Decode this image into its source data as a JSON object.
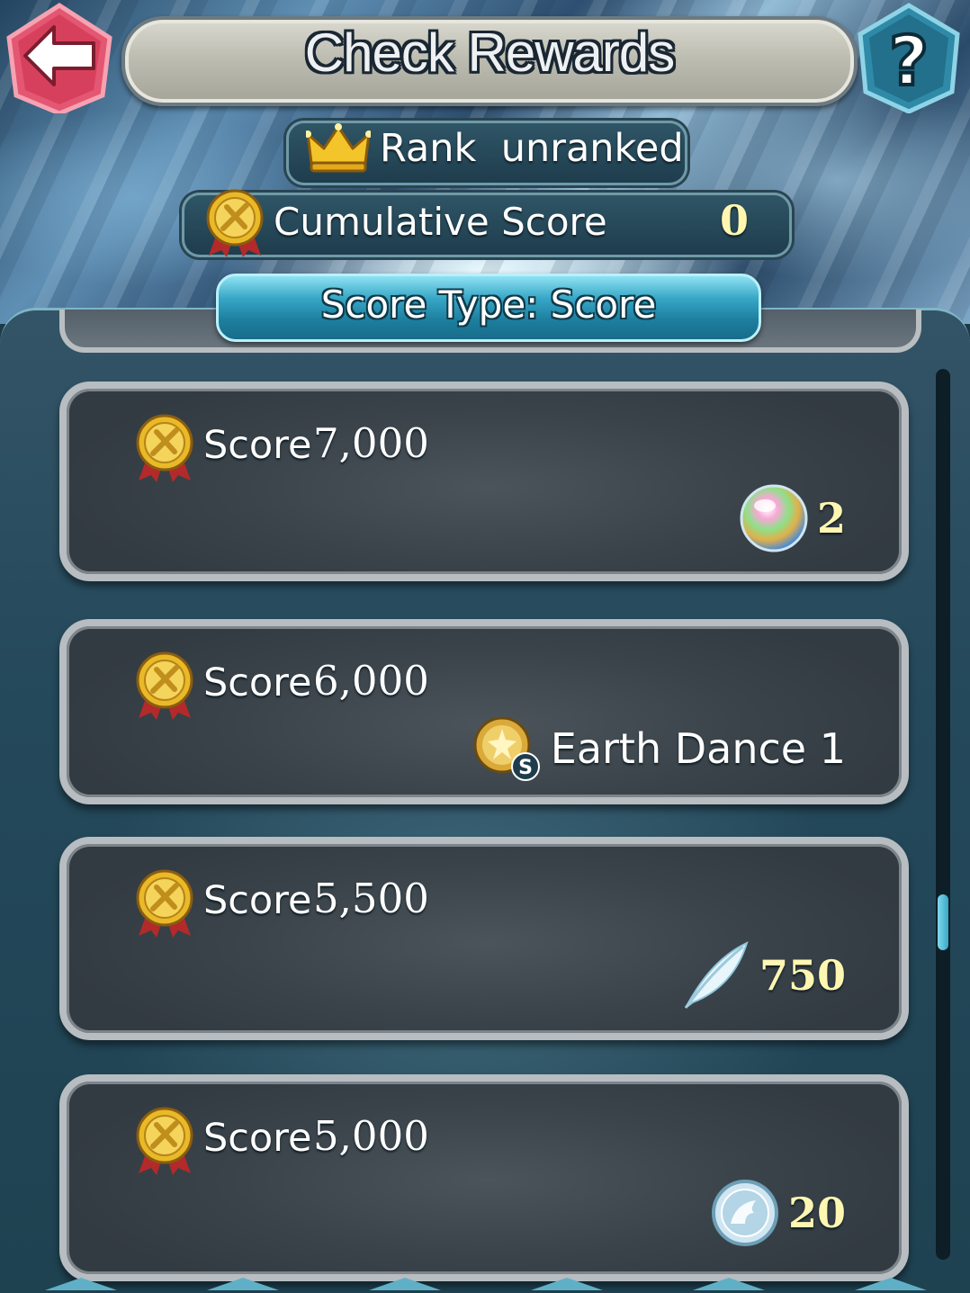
{
  "header": {
    "title": "Check Rewards",
    "back_icon": "back-arrow-icon",
    "help_icon": "question-mark-icon"
  },
  "rank": {
    "label": "Rank  unranked",
    "icon": "crown-icon"
  },
  "cumulative": {
    "label": "Cumulative Score",
    "value": "0",
    "icon": "medal-icon"
  },
  "score_type": {
    "label": "Score Type: Score"
  },
  "rewards": [
    {
      "score_label": "Score",
      "score_value": "7,000",
      "reward_icon": "orb-icon",
      "reward_qty": "2"
    },
    {
      "score_label": "Score",
      "score_value": "6,000",
      "reward_icon": "sacred-seal-icon",
      "reward_name": "Earth Dance 1"
    },
    {
      "score_label": "Score",
      "score_value": "5,500",
      "reward_icon": "feather-icon",
      "reward_qty": "750"
    },
    {
      "score_label": "Score",
      "score_value": "5,000",
      "reward_icon": "badge-icon",
      "reward_qty": "20"
    }
  ],
  "colors": {
    "gold_text": "#fff6b2",
    "accent": "#37a7c7",
    "back_button": "#e0506a",
    "help_button": "#2f8aa8"
  }
}
